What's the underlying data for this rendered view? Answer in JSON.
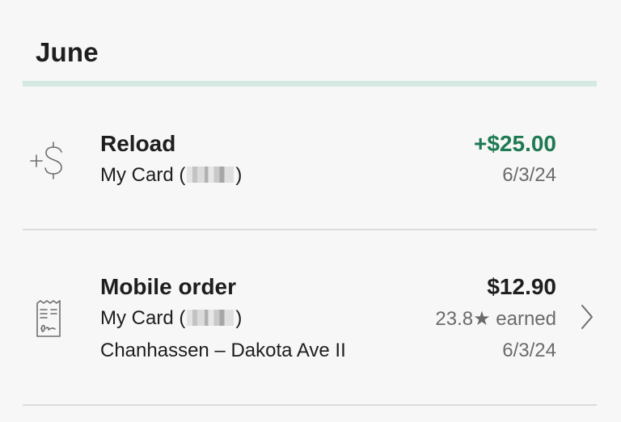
{
  "section": {
    "month": "June"
  },
  "transactions": [
    {
      "icon": "reload-dollar-icon",
      "title": "Reload",
      "card_prefix": "My Card (",
      "card_suffix": ")",
      "amount": "+$25.00",
      "amount_color": "#1e7a52",
      "date": "6/3/24"
    },
    {
      "icon": "receipt-icon",
      "title": "Mobile order",
      "card_prefix": "My Card (",
      "card_suffix": ")",
      "store": "Chanhassen – Dakota Ave II",
      "amount": "$12.90",
      "amount_color": "#1e1e1e",
      "stars": "23.8★ earned",
      "date": "6/3/24"
    }
  ]
}
